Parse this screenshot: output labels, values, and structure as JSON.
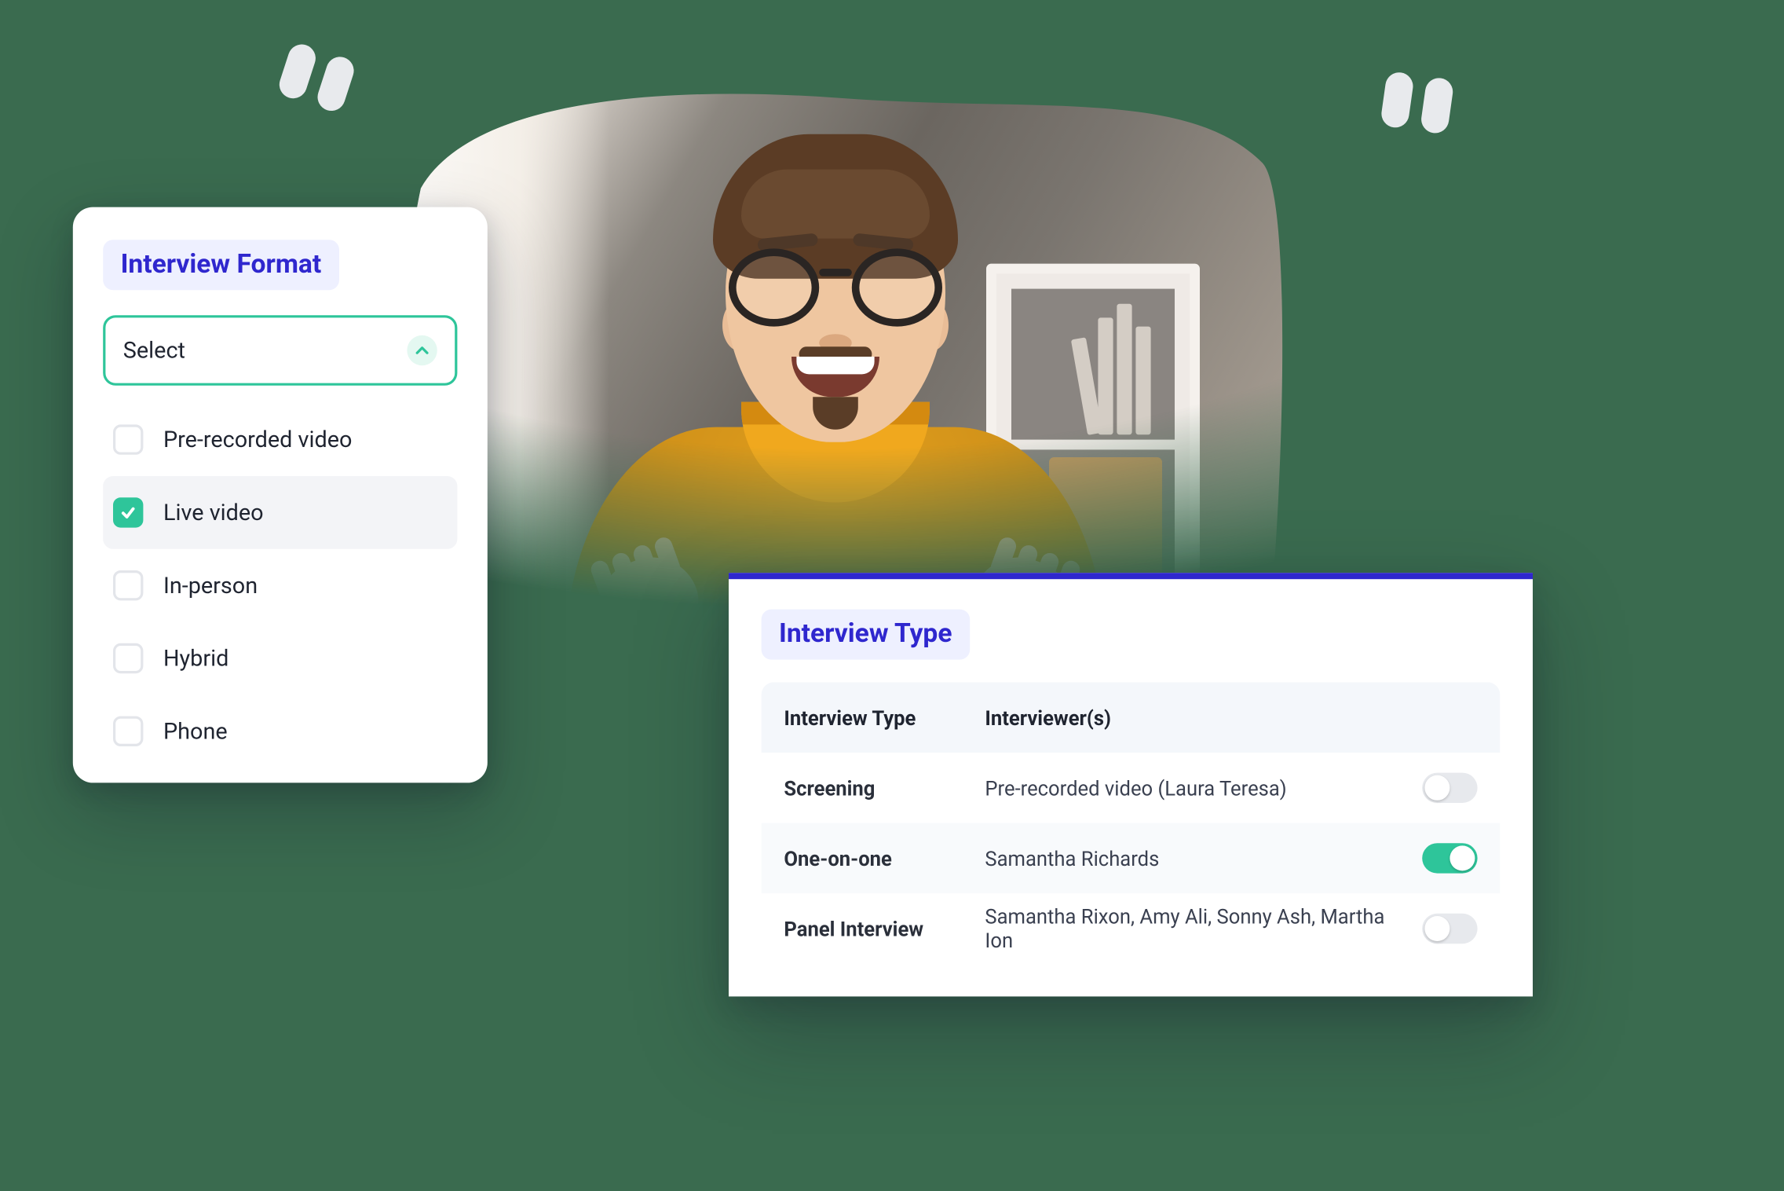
{
  "colors": {
    "accent_teal": "#2ec59a",
    "accent_indigo": "#2f27ce",
    "bg_green": "#3a6b4f"
  },
  "format_card": {
    "title": "Interview Format",
    "select_placeholder": "Select",
    "options": [
      {
        "label": "Pre-recorded video",
        "checked": false
      },
      {
        "label": "Live video",
        "checked": true
      },
      {
        "label": "In-person",
        "checked": false
      },
      {
        "label": "Hybrid",
        "checked": false
      },
      {
        "label": "Phone",
        "checked": false
      }
    ]
  },
  "type_card": {
    "title": "Interview Type",
    "headers": {
      "type": "Interview Type",
      "interviewers": "Interviewer(s)"
    },
    "rows": [
      {
        "type": "Screening",
        "interviewers": "Pre-recorded video  (Laura Teresa)",
        "enabled": false
      },
      {
        "type": "One-on-one",
        "interviewers": "Samantha Richards",
        "enabled": true
      },
      {
        "type": "Panel Interview",
        "interviewers": "Samantha Rixon, Amy Ali, Sonny Ash, Martha Ion",
        "enabled": false
      }
    ]
  }
}
